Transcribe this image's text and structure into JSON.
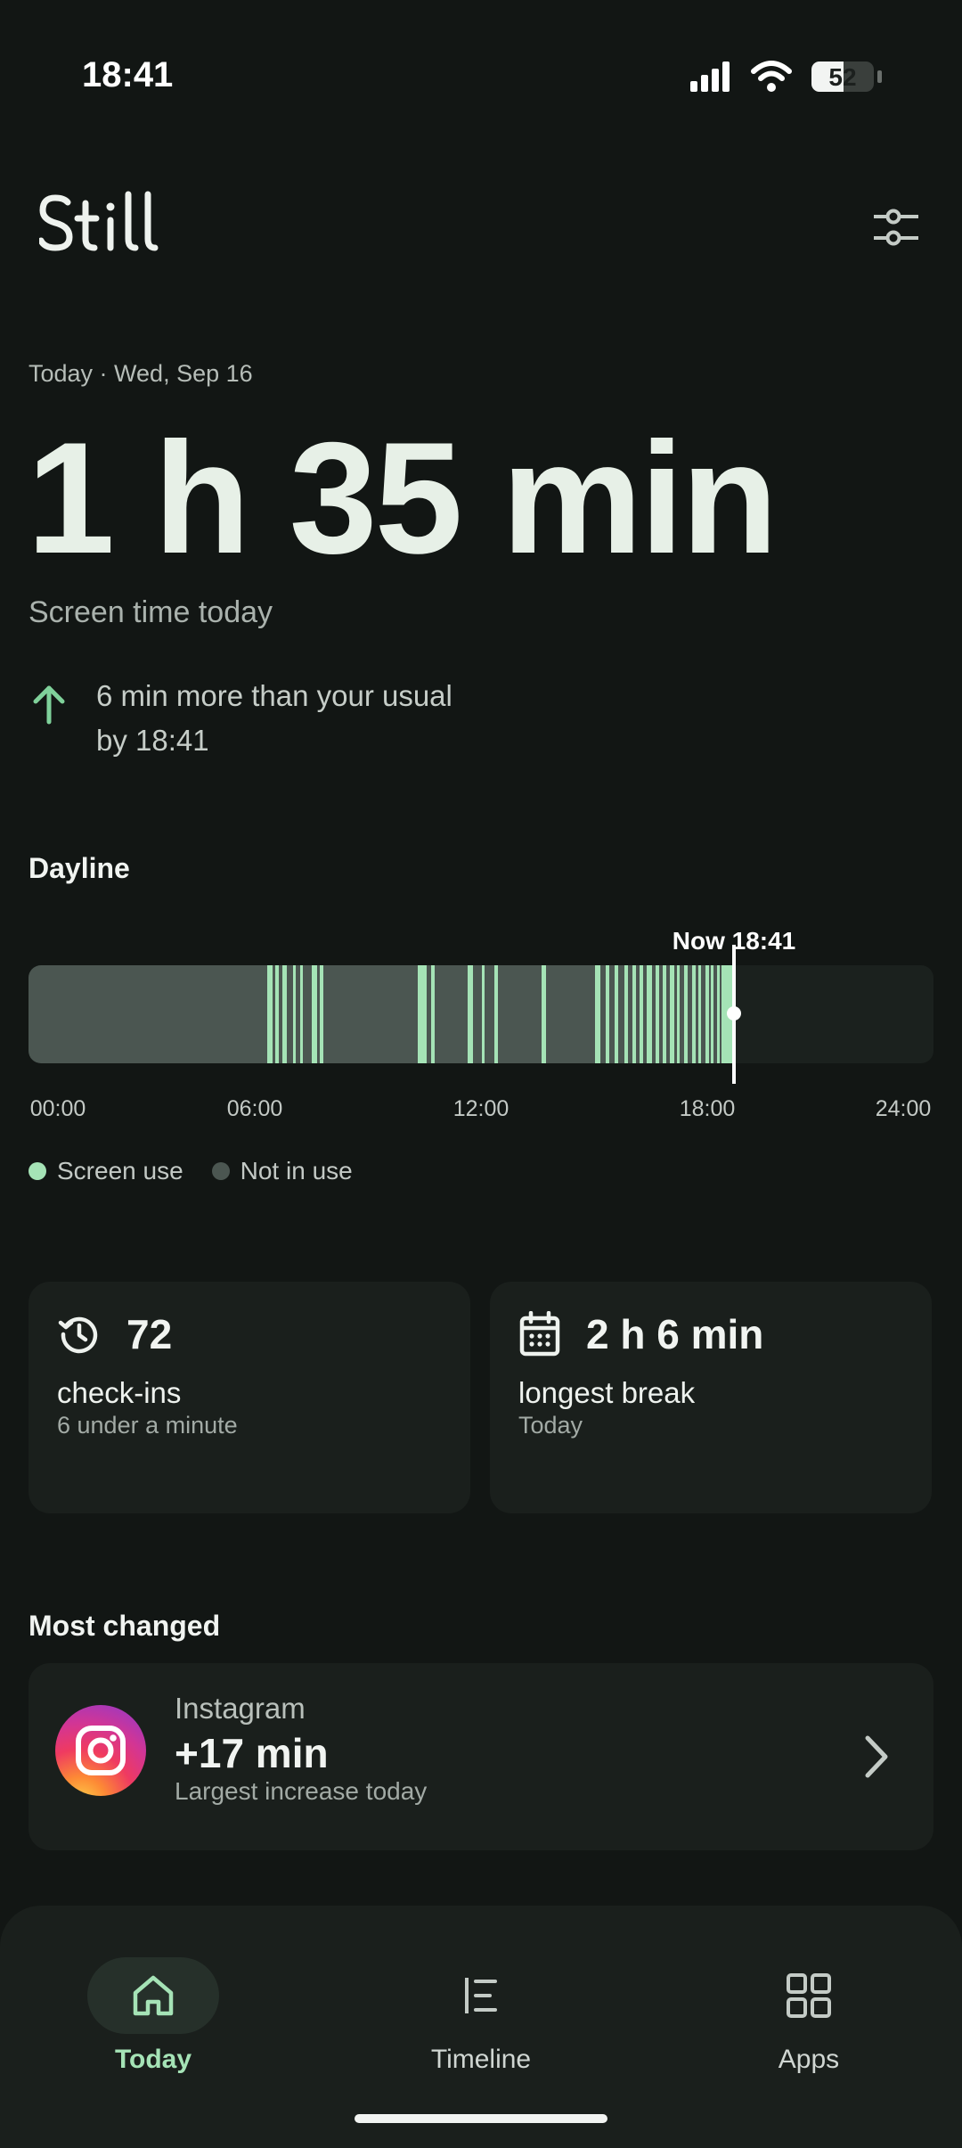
{
  "status_bar": {
    "time": "18:41",
    "battery": "52"
  },
  "app": {
    "logo_text": "Still"
  },
  "summary": {
    "date": "Today · Wed, Sep 16",
    "screen_time": "1 h 35 min",
    "screen_time_label": "Screen time today",
    "change_line1": "6 min more than your usual",
    "change_line2": "by 18:41"
  },
  "dayline": {
    "title": "Dayline",
    "now_label": "Now 18:41",
    "ticks": [
      "00:00",
      "06:00",
      "12:00",
      "18:00",
      "24:00"
    ],
    "legend": {
      "screen_use": "Screen use",
      "not_in_use": "Not in use"
    }
  },
  "stats": {
    "checkins": {
      "value": "72",
      "label": "check-ins",
      "sub": "6 under a minute"
    },
    "longest_break": {
      "value": "2 h 6 min",
      "label": "longest break",
      "sub": "Today"
    }
  },
  "most_changed": {
    "title": "Most changed",
    "app_name": "Instagram",
    "delta": "+17 min",
    "note": "Largest increase today"
  },
  "nav": {
    "today": "Today",
    "timeline": "Timeline",
    "apps": "Apps"
  },
  "colors": {
    "background": "#121614",
    "accent_green": "#a5e3b6",
    "not_in_use": "#4b5651",
    "card": "#1a1f1c"
  }
}
